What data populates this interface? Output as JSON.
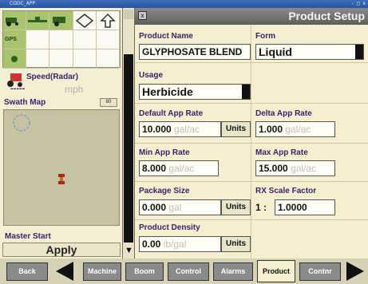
{
  "window": {
    "app_title": "CODC_APP",
    "controls": "-  □  x"
  },
  "left_panel": {
    "gps_label": "GPS",
    "speed_label": "Speed(Radar)",
    "speed_value": "-----",
    "speed_unit": "mph",
    "swath_label": "Swath Map",
    "swath_button": "80",
    "master_label": "Master Start",
    "apply_label": "Apply"
  },
  "header": {
    "close_glyph": "x",
    "title": "Product Setup"
  },
  "form": {
    "product_name": {
      "label": "Product Name",
      "value": "GLYPHOSATE BLEND"
    },
    "form_field": {
      "label": "Form",
      "value": "Liquid"
    },
    "usage": {
      "label": "Usage",
      "value": "Herbicide"
    },
    "default_app_rate": {
      "label": "Default App Rate",
      "value": "10.000",
      "unit": "gal/ac",
      "button": "Units"
    },
    "delta_app_rate": {
      "label": "Delta App Rate",
      "value": "1.000",
      "unit": "gal/ac"
    },
    "min_app_rate": {
      "label": "Min App Rate",
      "value": "8.000",
      "unit": "gal/ac"
    },
    "max_app_rate": {
      "label": "Max App Rate",
      "value": "15.000",
      "unit": "gal/ac"
    },
    "package_size": {
      "label": "Package Size",
      "value": "0.000",
      "unit": "gal",
      "button": "Units"
    },
    "rx_scale_factor": {
      "label": "RX Scale Factor",
      "prefix": "1 :",
      "value": "1.0000"
    },
    "product_density": {
      "label": "Product Density",
      "value": "0.00",
      "unit": "lb/gal",
      "button": "Units"
    }
  },
  "tabs": {
    "back": "Back",
    "machine": "Machine",
    "boom": "Boom",
    "control": "Control",
    "alarms": "Alarms",
    "product": "Product",
    "contnr": "Contnr"
  },
  "colors": {
    "label_text": "#3a1f6a",
    "form_bg": "#f5efcf",
    "header_bg": "#6e6e6e"
  }
}
